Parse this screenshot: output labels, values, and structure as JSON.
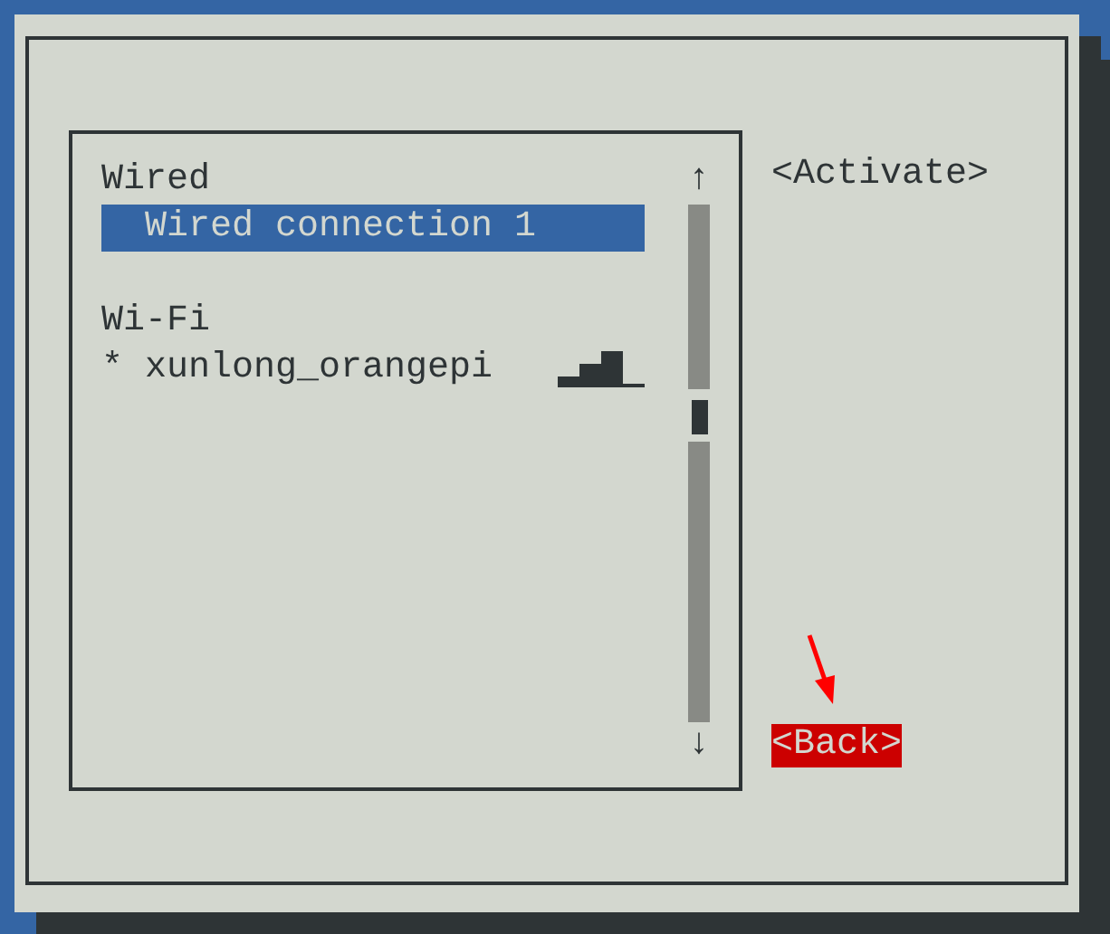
{
  "list": {
    "scroll_up": "↑",
    "scroll_down": "↓",
    "sections": [
      {
        "title": "Wired",
        "items": [
          {
            "kind": "wired",
            "label": "Wired connection 1",
            "selected": true
          }
        ]
      },
      {
        "title": "Wi-Fi",
        "items": [
          {
            "kind": "wifi",
            "marker": "*",
            "label": "xunlong_orangepi",
            "selected": false
          }
        ]
      }
    ]
  },
  "buttons": [
    {
      "label": "<Activate>",
      "focused": false
    },
    {
      "label": "<Back>",
      "focused": true
    }
  ]
}
